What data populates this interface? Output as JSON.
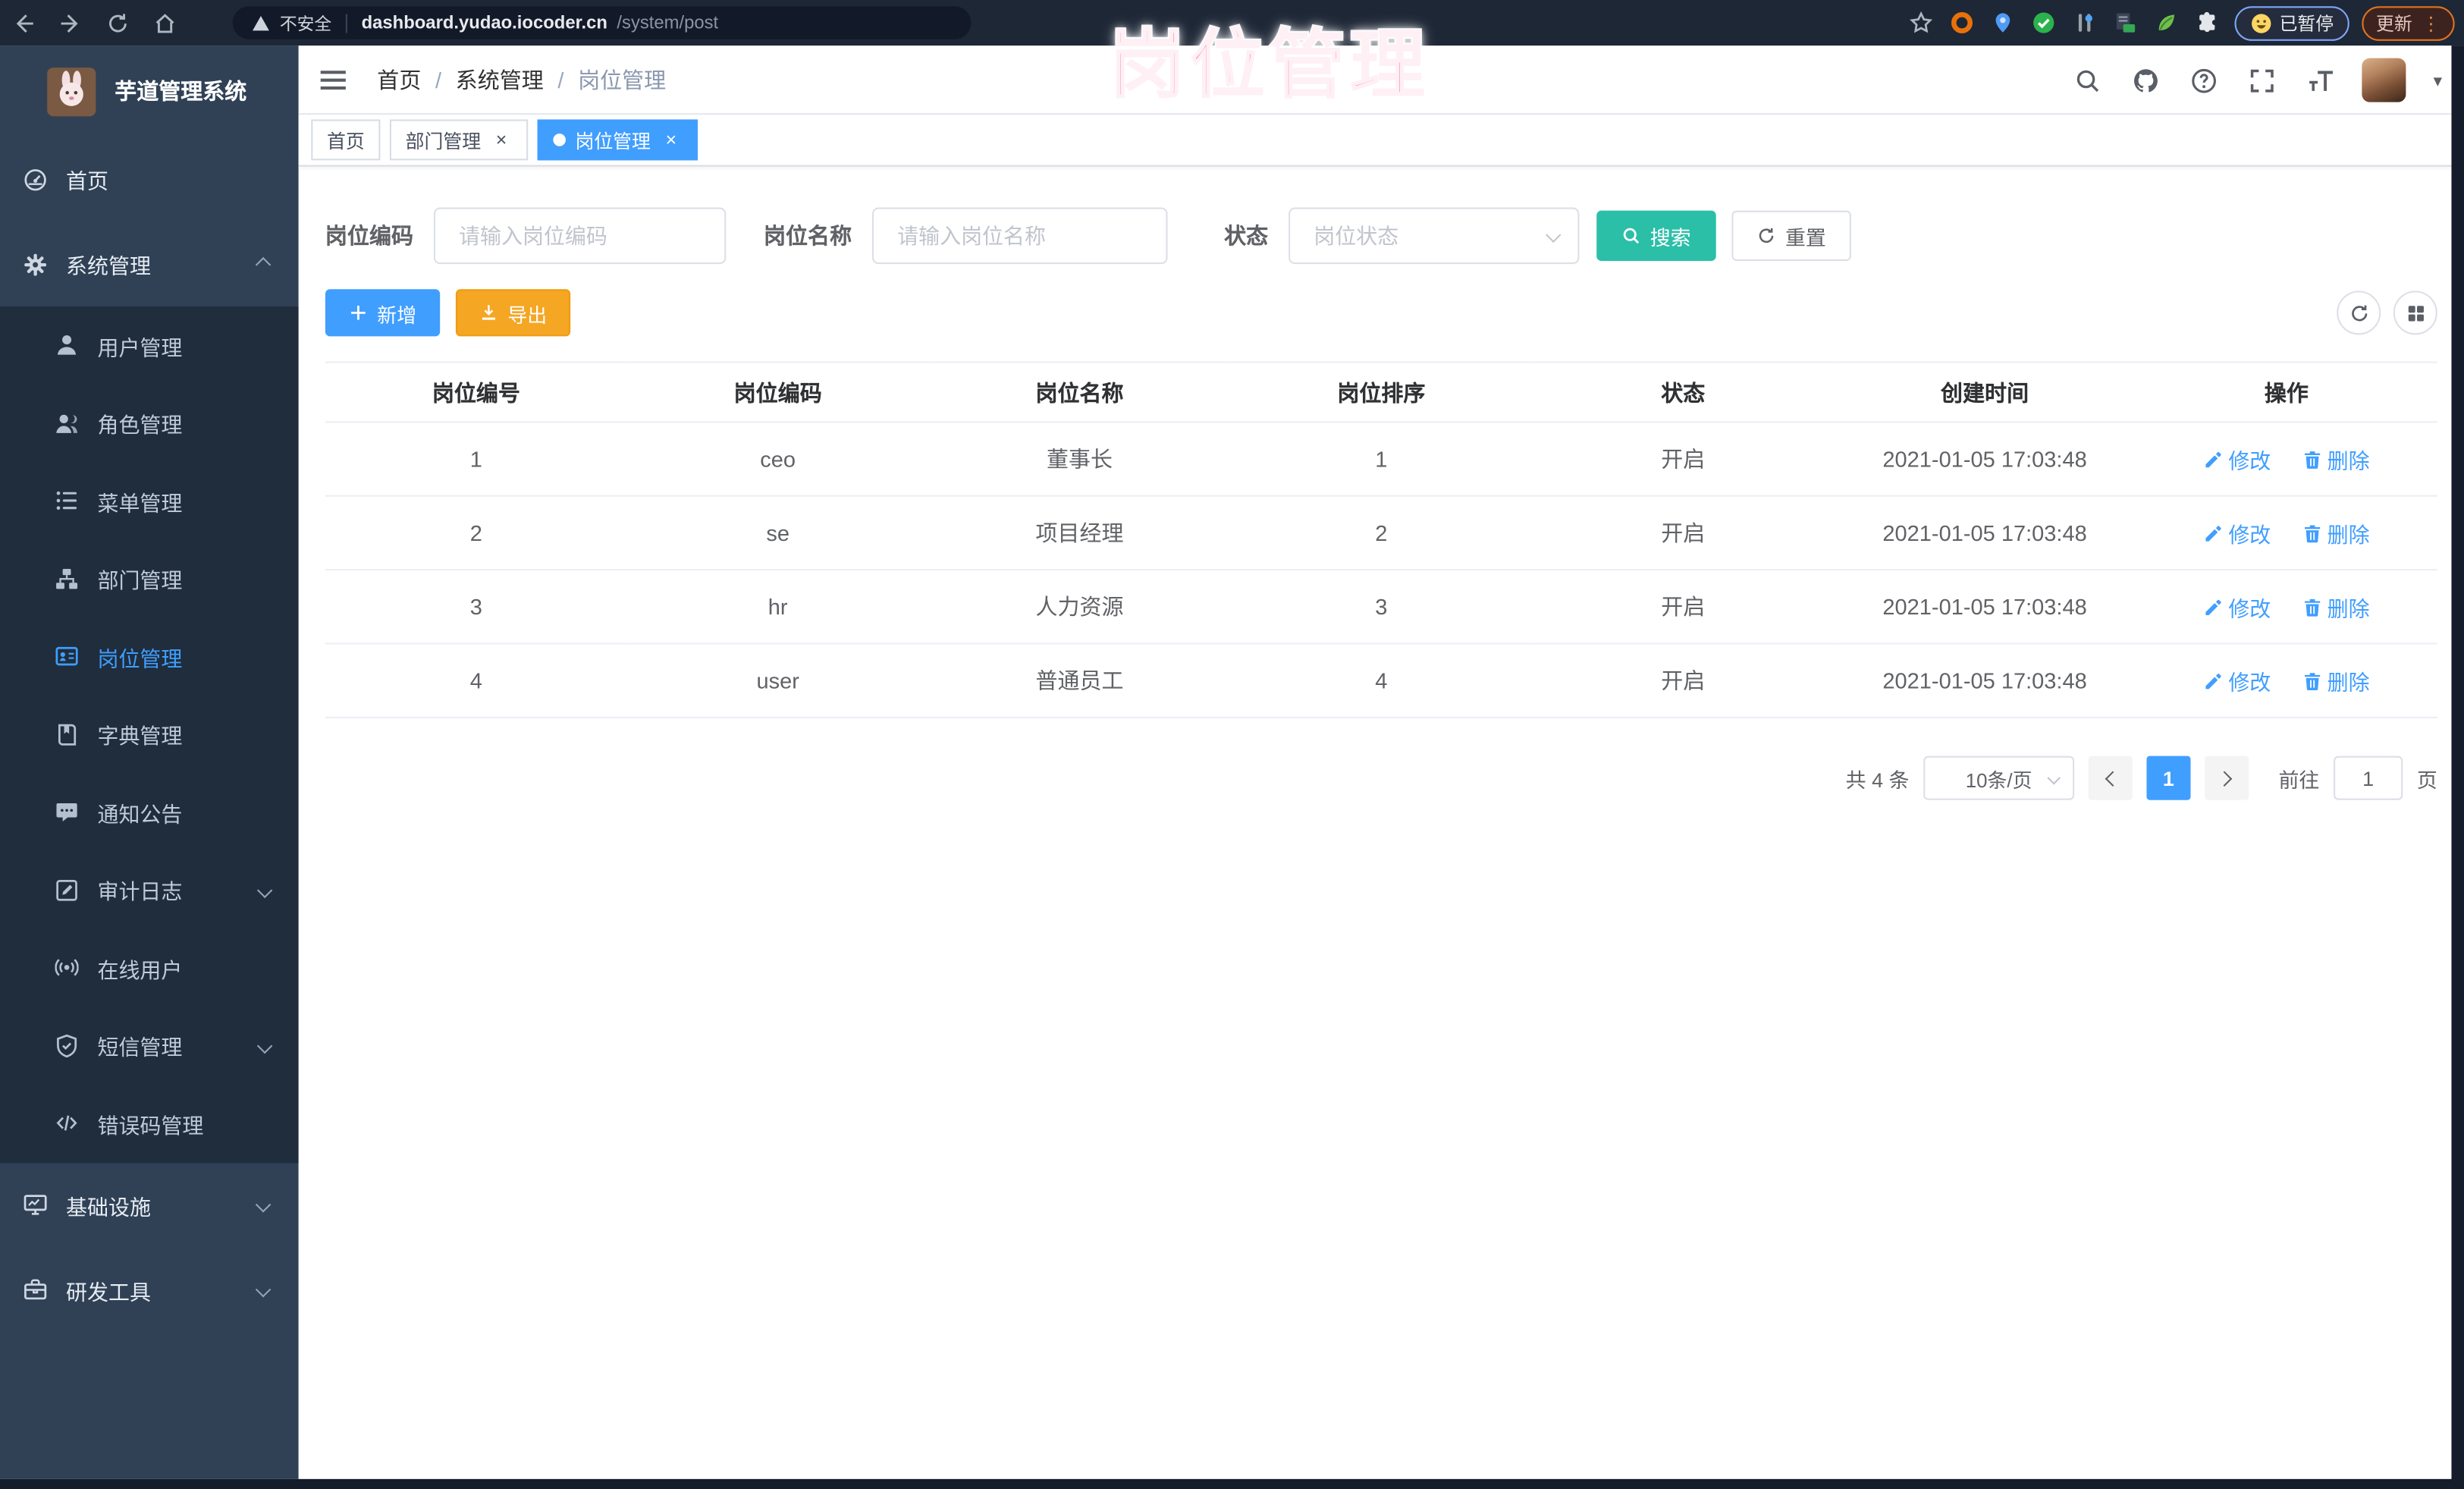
{
  "browser": {
    "security_label": "不安全",
    "url_host": "dashboard.yudao.iocoder.cn",
    "url_path": "/system/post",
    "paused_badge": "已暂停",
    "update_button": "更新"
  },
  "watermark": {
    "text": "岗位管理",
    "color": "#f34174"
  },
  "icons": {
    "close": "×",
    "caret": "▾",
    "more": "⋮"
  },
  "sidebar": {
    "logo_title": "芋道管理系统",
    "home_label": "首页",
    "system_label": "系统管理",
    "system_children": [
      {
        "label": "用户管理"
      },
      {
        "label": "角色管理"
      },
      {
        "label": "菜单管理"
      },
      {
        "label": "部门管理"
      },
      {
        "label": "岗位管理",
        "active": true
      },
      {
        "label": "字典管理"
      },
      {
        "label": "通知公告"
      },
      {
        "label": "审计日志"
      },
      {
        "label": "在线用户"
      },
      {
        "label": "短信管理"
      },
      {
        "label": "错误码管理"
      }
    ],
    "bottom_items": [
      {
        "label": "基础设施"
      },
      {
        "label": "研发工具"
      }
    ]
  },
  "navbar": {
    "breadcrumb": [
      "首页",
      "系统管理",
      "岗位管理"
    ]
  },
  "tabs": [
    {
      "label": "首页"
    },
    {
      "label": "部门管理"
    },
    {
      "label": "岗位管理",
      "active": true
    }
  ],
  "filters": {
    "code_label": "岗位编码",
    "code_placeholder": "请输入岗位编码",
    "name_label": "岗位名称",
    "name_placeholder": "请输入岗位名称",
    "status_label": "状态",
    "status_placeholder": "岗位状态",
    "search_button": "搜索",
    "reset_button": "重置"
  },
  "toolbar": {
    "add_button": "新增",
    "export_button": "导出"
  },
  "table": {
    "columns": [
      "岗位编号",
      "岗位编码",
      "岗位名称",
      "岗位排序",
      "状态",
      "创建时间",
      "操作"
    ],
    "edit_label": "修改",
    "delete_label": "删除",
    "rows": [
      {
        "id": "1",
        "code": "ceo",
        "name": "董事长",
        "sort": "1",
        "status": "开启",
        "created": "2021-01-05 17:03:48"
      },
      {
        "id": "2",
        "code": "se",
        "name": "项目经理",
        "sort": "2",
        "status": "开启",
        "created": "2021-01-05 17:03:48"
      },
      {
        "id": "3",
        "code": "hr",
        "name": "人力资源",
        "sort": "3",
        "status": "开启",
        "created": "2021-01-05 17:03:48"
      },
      {
        "id": "4",
        "code": "user",
        "name": "普通员工",
        "sort": "4",
        "status": "开启",
        "created": "2021-01-05 17:03:48"
      }
    ]
  },
  "pagination": {
    "total_label": "共 4 条",
    "page_size": "10条/页",
    "current_page": "1",
    "goto_label": "前往",
    "goto_value": "1",
    "goto_suffix": "页"
  },
  "colors": {
    "accent": "#409eff",
    "search_teal": "#2bbfa8",
    "export_orange": "#f5a623",
    "watermark_pink": "#f34174",
    "sidebar_bg": "#304156",
    "submenu_bg": "#1f2d3d",
    "chrome_bg": "#1e2736"
  }
}
